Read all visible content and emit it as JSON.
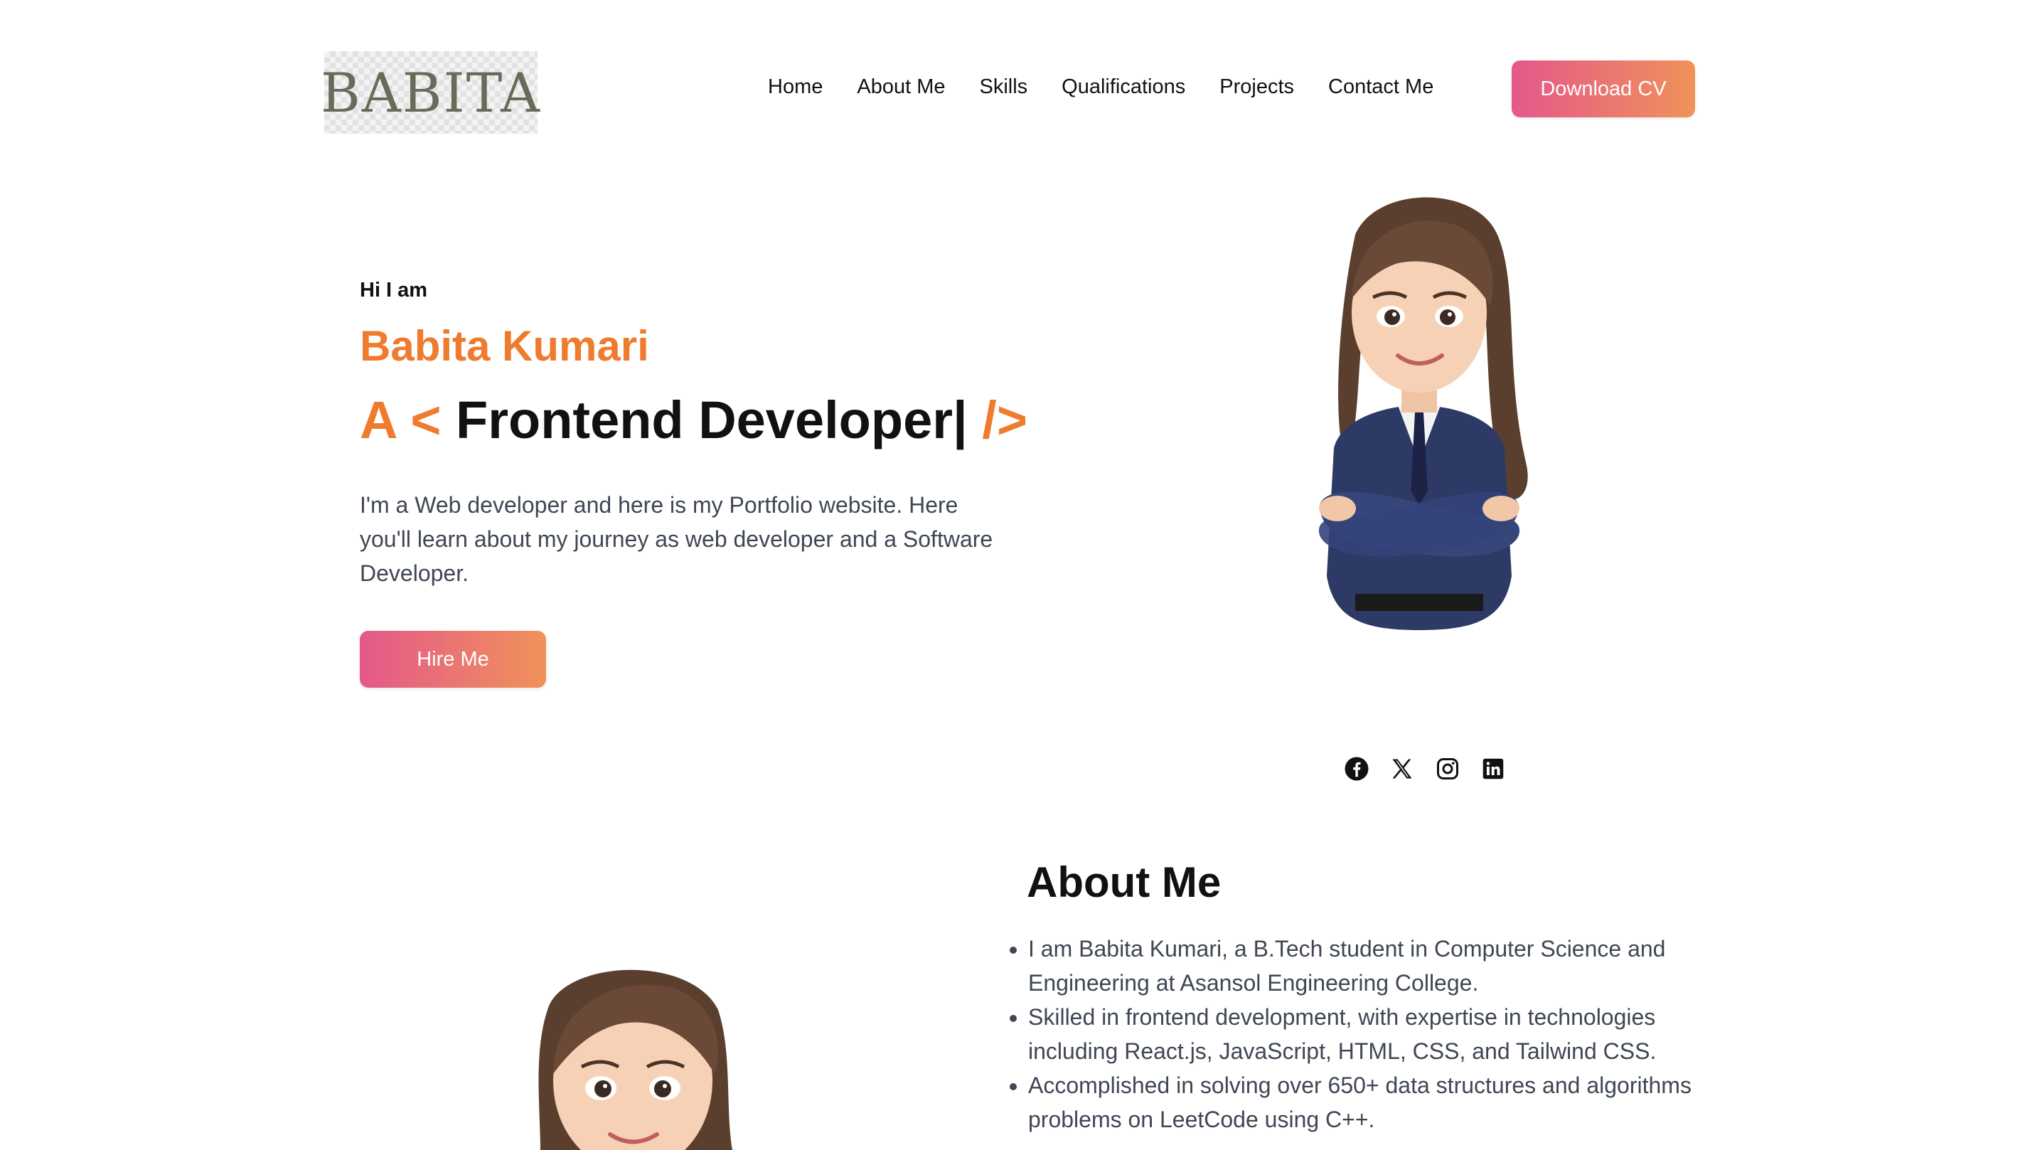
{
  "logo": {
    "text": "BABITA"
  },
  "nav": {
    "items": [
      "Home",
      "About Me",
      "Skills",
      "Qualifications",
      "Projects",
      "Contact Me"
    ],
    "download_label": "Download CV"
  },
  "hero": {
    "greeting": "Hi I am",
    "name": "Babita Kumari",
    "role_prefix": "A <",
    "role_text": "Frontend Developer|",
    "role_suffix": "/>",
    "intro": "I'm a Web developer and here is my Portfolio website. Here you'll learn about my journey as web developer and a Software Developer.",
    "hire_label": "Hire Me"
  },
  "socials": [
    "facebook-icon",
    "x-icon",
    "instagram-icon",
    "linkedin-icon"
  ],
  "about": {
    "title": "About Me",
    "points": [
      "I am Babita Kumari, a B.Tech student in Computer Science and Engineering at Asansol Engineering College.",
      "Skilled in frontend development, with expertise in technologies including React.js, JavaScript, HTML, CSS, and Tailwind CSS.",
      "Accomplished in solving over 650+ data structures and algorithms problems on LeetCode using C++."
    ]
  },
  "colors": {
    "accent": "#ef7b2f",
    "gradient_start": "#e4588a",
    "gradient_end": "#f0925a",
    "body_text": "#3f4654"
  }
}
